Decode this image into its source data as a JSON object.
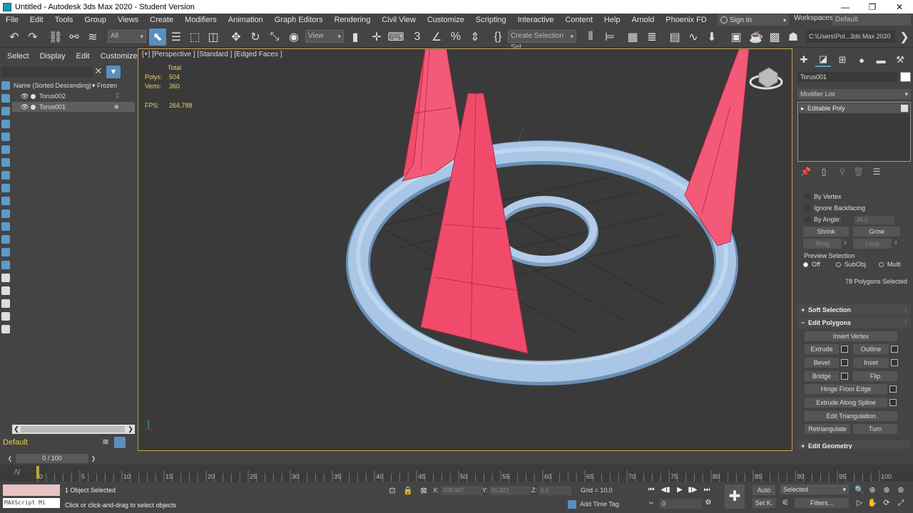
{
  "window": {
    "title": "Untitled - Autodesk 3ds Max 2020 - Student Version",
    "controls": [
      "—",
      "❐",
      "✕"
    ]
  },
  "menubar": {
    "items": [
      "File",
      "Edit",
      "Tools",
      "Group",
      "Views",
      "Create",
      "Modifiers",
      "Animation",
      "Graph Editors",
      "Rendering",
      "Civil View",
      "Customize",
      "Scripting",
      "Interactive",
      "Content",
      "Help",
      "Arnold",
      "Phoenix FD"
    ],
    "sign_in": "Sign In",
    "workspaces_label": "Workspaces:",
    "workspace_value": "Default"
  },
  "toolbar": {
    "filter_value": "All",
    "view_value": "View",
    "selection_set": "Create Selection Set",
    "project_path": "C:\\Users\\Pol...3ds Max 2020"
  },
  "scene_explorer": {
    "tabs": [
      "Select",
      "Display",
      "Edit",
      "Customize"
    ],
    "col_name": "Name (Sorted Descending)",
    "col_frozen": "▾ Frozen",
    "rows": [
      {
        "name": "Torus002",
        "selected": false
      },
      {
        "name": "Torus001",
        "selected": true
      }
    ],
    "layer": "Default"
  },
  "viewport": {
    "label": "[+] [Perspective ] [Standard ] [Edged Faces ]",
    "stats_header": "Total",
    "polys_label": "Polys:",
    "polys_value": "504",
    "verts_label": "Verts:",
    "verts_value": "360",
    "fps_label": "FPS:",
    "fps_value": "264,788",
    "colors": {
      "background": "#3a3a3a",
      "selected_faces": "#f04b6a",
      "torus": "#a9c6e6",
      "border": "#c4a24a"
    }
  },
  "command_panel": {
    "object_name": "Torus001",
    "modifier_list": "Modifier List",
    "stack": [
      "Editable Poly"
    ],
    "selection": {
      "by_vertex": "By Vertex",
      "ignore_backfacing": "Ignore Backfacing",
      "by_angle": "By Angle:",
      "angle_value": "45,0",
      "shrink": "Shrink",
      "grow": "Grow",
      "ring": "Ring",
      "loop": "Loop",
      "preview_label": "Preview Selection",
      "preview_options": [
        "Off",
        "SubObj",
        "Multi"
      ],
      "count_text": "78 Polygons Selected"
    },
    "rollouts": {
      "soft_selection": "Soft Selection",
      "edit_polygons": "Edit Polygons",
      "edit_geometry": "Edit Geometry"
    },
    "edit_polygons": {
      "insert_vertex": "Insert Vertex",
      "extrude": "Extrude",
      "outline": "Outline",
      "bevel": "Bevel",
      "inset": "Inset",
      "bridge": "Bridge",
      "flip": "Flip",
      "hinge": "Hinge From Edge",
      "extrude_spline": "Extrude Along Spline",
      "edit_triangulation": "Edit Triangulation",
      "retriangulate": "Retriangulate",
      "turn": "Turn"
    }
  },
  "timeline": {
    "frame_label": "0 / 100",
    "ticks": [
      "5",
      "10",
      "15",
      "20",
      "25",
      "30",
      "35",
      "40",
      "45",
      "50",
      "55",
      "60",
      "65",
      "70",
      "75",
      "80",
      "85",
      "90",
      "95",
      "100"
    ],
    "tick_zero": "0",
    "current_frame": 0
  },
  "statusbar": {
    "maxscript": "MAXScript Mi",
    "selection_status": "1 Object Selected",
    "prompt": "Click or click-and-drag to select objects",
    "x_label": "X:",
    "x_value": "209,087",
    "y_label": "Y:",
    "y_value": "55,822",
    "z_label": "Z:",
    "z_value": "0,0",
    "grid": "Grid = 10,0",
    "add_time_tag": "Add Time Tag",
    "frame_value": "0",
    "auto": "Auto",
    "set_key": "Set K.",
    "selected_drop": "Selected",
    "filters": "Filters..."
  }
}
